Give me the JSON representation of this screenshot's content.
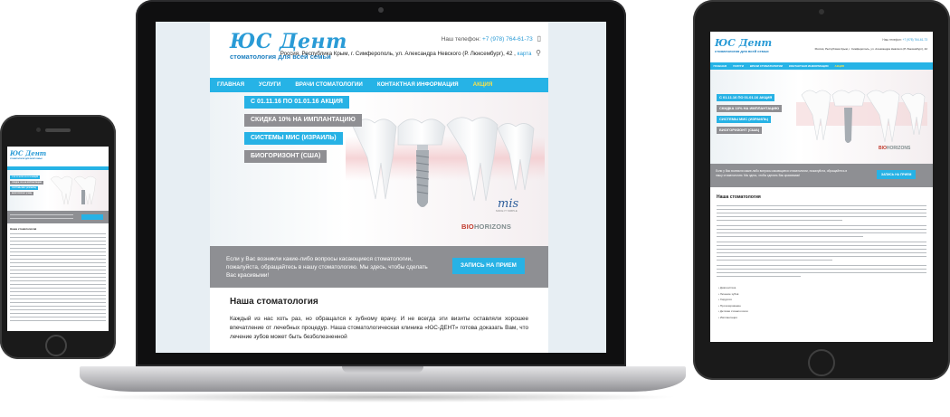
{
  "site": {
    "logo": "ЮС Дент",
    "tagline": "стоматология для всей семьи",
    "phone_label": "Наш телефон:",
    "phone_number": "+7 (978) 764-61-73",
    "address": "Россия, Республика Крым, г. Симферополь, ул. Александра Невского (Р. Люксембург), 42",
    "map_link": "карта",
    "nav": [
      "ГЛАВНАЯ",
      "УСЛУГИ",
      "ВРАЧИ СТОМАТОЛОГИИ",
      "КОНТАКТНАЯ ИНФОРМАЦИЯ",
      "АКЦИЯ"
    ],
    "promo": [
      "С 01.11.16 ПО 01.01.16 АКЦИЯ",
      "СКИДКА 10% НА ИМПЛАНТАЦИЮ",
      "СИСТЕМЫ МИС (ИЗРАИЛЬ)",
      "БИОГОРИЗОНТ (США)"
    ],
    "partner_logo_1": "mis",
    "partner_logo_1_sub": "MAKE IT SIMPLE",
    "partner_logo_2_a": "BIO",
    "partner_logo_2_b": "HORIZONS",
    "cta_text": "Если у Вас возникли какие-либо вопросы касающиеся стоматологии, пожалуйста, обращайтесь в нашу стоматологию. Мы здесь, чтобы сделать Вас красивыми!",
    "cta_button": "ЗАПИСЬ НА ПРИЕМ",
    "about_title": "Наша стоматология",
    "about_text": "Каждый из нас хоть раз, но обращался к зубному врачу. И не всегда эти визиты оставляли хорошее впечатление от лечебных процедур. Наша стоматологическая клиника «ЮС-ДЕНТ» готова доказать Вам, что лечение зубов может быть безболезненной"
  },
  "tablet": {
    "bullets": [
      "Диагностика",
      "Лечение зубов",
      "Хирургия",
      "Протезирование",
      "Детская стоматология",
      "Имплантация"
    ]
  },
  "colors": {
    "accent": "#26b3e6",
    "nav_active": "#f7e24b",
    "cta_bg": "#8e8f93",
    "logo_blue": "#2a9bd6"
  },
  "icons": {
    "phone": "mobile-phone-icon",
    "location": "map-pin-icon"
  }
}
